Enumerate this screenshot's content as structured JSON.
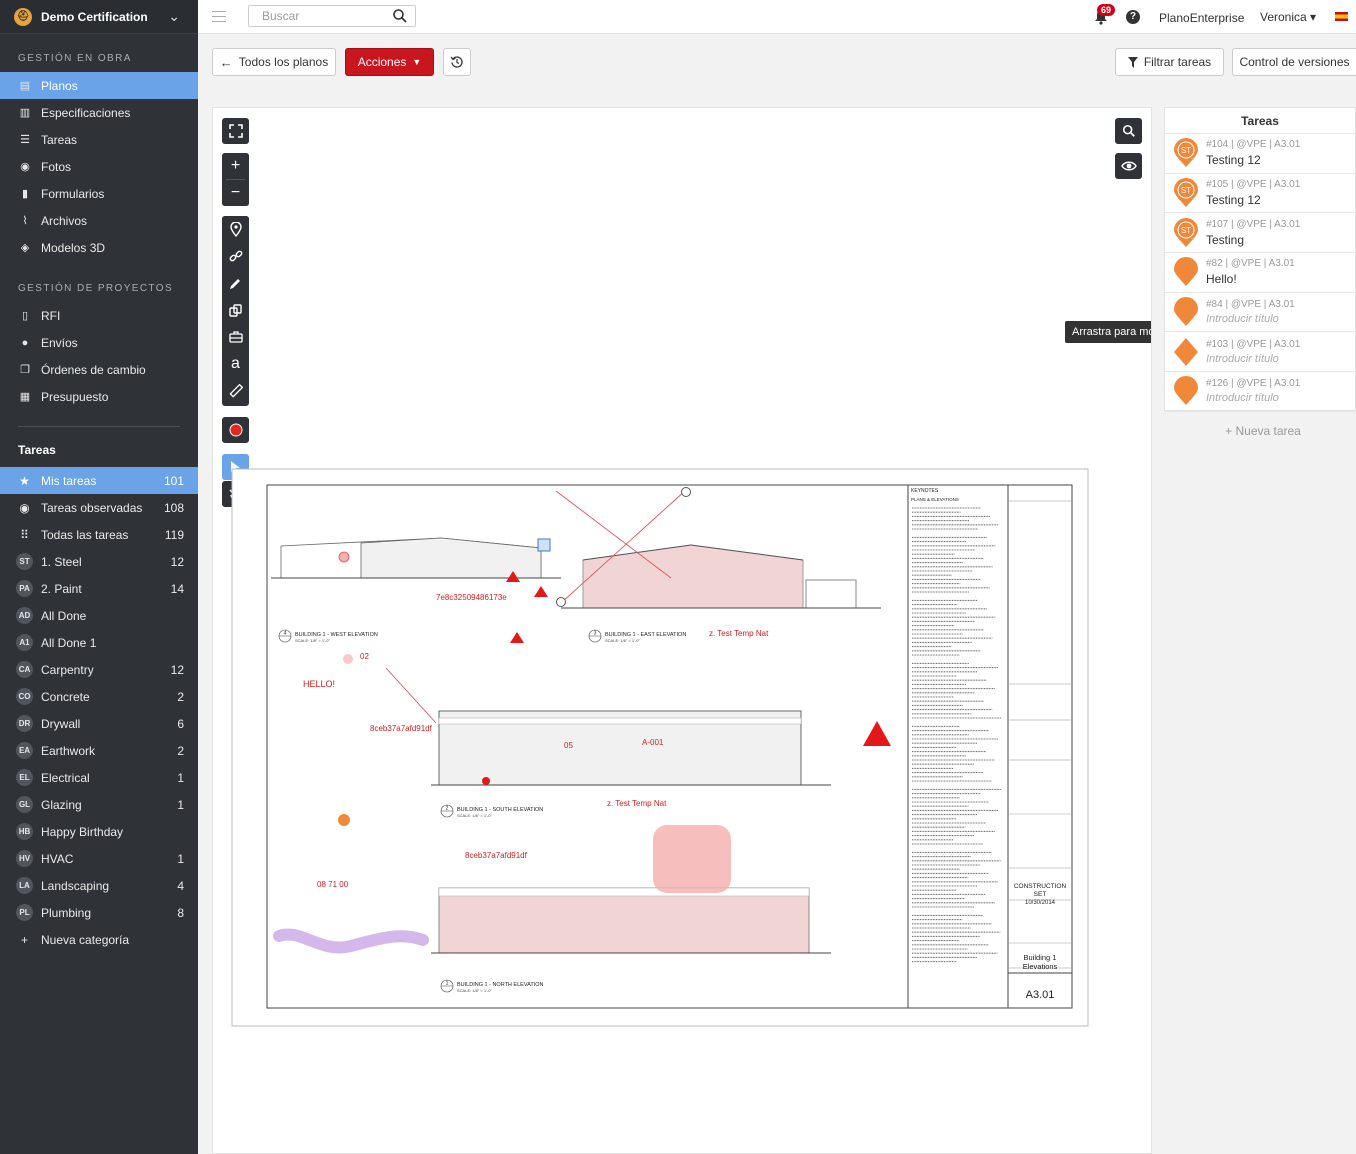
{
  "brand": {
    "name": "Demo Certification",
    "logo_icon": "hardhat-icon"
  },
  "topbar": {
    "search_placeholder": "Buscar",
    "notifications": "69",
    "help": "?",
    "company": "PlanoEnterprise",
    "user": "Veronica ▾"
  },
  "sidebar": {
    "section1": "GESTIÓN EN OBRA",
    "section1_items": [
      {
        "label": "Planos",
        "icon": "blueprint-icon"
      },
      {
        "label": "Especificaciones",
        "icon": "book-icon"
      },
      {
        "label": "Tareas",
        "icon": "list-icon"
      },
      {
        "label": "Fotos",
        "icon": "camera-icon"
      },
      {
        "label": "Formularios",
        "icon": "clipboard-icon"
      },
      {
        "label": "Archivos",
        "icon": "paperclip-icon"
      },
      {
        "label": "Modelos 3D",
        "icon": "cube-icon"
      }
    ],
    "section2": "GESTIÓN DE PROYECTOS",
    "section2_items": [
      {
        "label": "RFI",
        "icon": "document-icon"
      },
      {
        "label": "Envíos",
        "icon": "user-icon"
      },
      {
        "label": "Órdenes de cambio",
        "icon": "copy-icon"
      },
      {
        "label": "Presupuesto",
        "icon": "calculator-icon"
      }
    ],
    "tasks_title": "Tareas",
    "task_filters": [
      {
        "label": "Mis tareas",
        "count": "101",
        "icon": "star-icon"
      },
      {
        "label": "Tareas observadas",
        "count": "108",
        "icon": "eye-icon"
      },
      {
        "label": "Todas las tareas",
        "count": "119",
        "icon": "grid-icon"
      }
    ],
    "categories": [
      {
        "abbr": "ST",
        "label": "1. Steel",
        "count": "12"
      },
      {
        "abbr": "PA",
        "label": "2. Paint",
        "count": "14"
      },
      {
        "abbr": "AD",
        "label": "All Done",
        "count": ""
      },
      {
        "abbr": "A1",
        "label": "All Done 1",
        "count": ""
      },
      {
        "abbr": "CA",
        "label": "Carpentry",
        "count": "12"
      },
      {
        "abbr": "CO",
        "label": "Concrete",
        "count": "2"
      },
      {
        "abbr": "DR",
        "label": "Drywall",
        "count": "6"
      },
      {
        "abbr": "EA",
        "label": "Earthwork",
        "count": "2"
      },
      {
        "abbr": "EL",
        "label": "Electrical",
        "count": "1"
      },
      {
        "abbr": "GL",
        "label": "Glazing",
        "count": "1"
      },
      {
        "abbr": "HB",
        "label": "Happy Birthday",
        "count": ""
      },
      {
        "abbr": "HV",
        "label": "HVAC",
        "count": "1"
      },
      {
        "abbr": "LA",
        "label": "Landscaping",
        "count": "4"
      },
      {
        "abbr": "PL",
        "label": "Plumbing",
        "count": "8"
      }
    ],
    "new_category": "Nueva categoría"
  },
  "toolbar": {
    "all_plans": "Todos los planos",
    "actions": "Acciones",
    "filter_tasks": "Filtrar tareas",
    "version_control": "Control de versiones"
  },
  "viewer": {
    "tooltip": "Arrastra para mo",
    "text_tool": "a"
  },
  "drawing": {
    "keynotes_title": "KEYNOTES",
    "keynotes_sub": "PLANS & ELEVATIONS",
    "stamp": "CONSTRUCTION\nSET",
    "date": "10/30/2014",
    "sheet_title": "Building 1 Elevations",
    "sheet_no": "A3.01",
    "views": [
      "BUILDING 1 - WEST ELEVATION",
      "BUILDING 1 - EAST ELEVATION",
      "BUILDING 1 - SOUTH ELEVATION",
      "BUILDING 1 - NORTH ELEVATION"
    ],
    "view_nums": [
      "4",
      "3",
      "2",
      "1"
    ],
    "scale": "SCALE: 1/8\" = 1'-0\"",
    "markups": {
      "m1": "7e8c32509486173e",
      "m2": "z. Test Temp Nat",
      "m3": "02",
      "m4": "HELLO!",
      "m5": "8ceb37a7afd91df",
      "m6": "05",
      "m7": "A-001",
      "m8": "z. Test Temp Nat",
      "m9": "8ceb37a7afd91df",
      "m10": "08 71 00"
    }
  },
  "tasks_panel": {
    "title": "Tareas",
    "items": [
      {
        "meta": "#104 | @VPE | A3.01",
        "name": "Testing 12",
        "badge": "ST",
        "placeholder": false,
        "shape": "pin"
      },
      {
        "meta": "#105 | @VPE | A3.01",
        "name": "Testing 12",
        "badge": "ST",
        "placeholder": false,
        "shape": "pin"
      },
      {
        "meta": "#107 | @VPE | A3.01",
        "name": "Testing",
        "badge": "ST",
        "placeholder": false,
        "shape": "pin"
      },
      {
        "meta": "#82 | @VPE | A3.01",
        "name": "Hello!",
        "badge": "",
        "placeholder": false,
        "shape": "pin"
      },
      {
        "meta": "#84 | @VPE | A3.01",
        "name": "Introducir título",
        "badge": "",
        "placeholder": true,
        "shape": "pin"
      },
      {
        "meta": "#103 | @VPE | A3.01",
        "name": "Introducir título",
        "badge": "",
        "placeholder": true,
        "shape": "diamond"
      },
      {
        "meta": "#126 | @VPE | A3.01",
        "name": "Introducir título",
        "badge": "",
        "placeholder": true,
        "shape": "pin"
      }
    ],
    "new_task": "+ Nueva tarea"
  },
  "colors": {
    "sidebar": "#2f3337",
    "active": "#6aa3e8",
    "accent_red": "#c9151e",
    "pin_orange": "#f0883a"
  }
}
